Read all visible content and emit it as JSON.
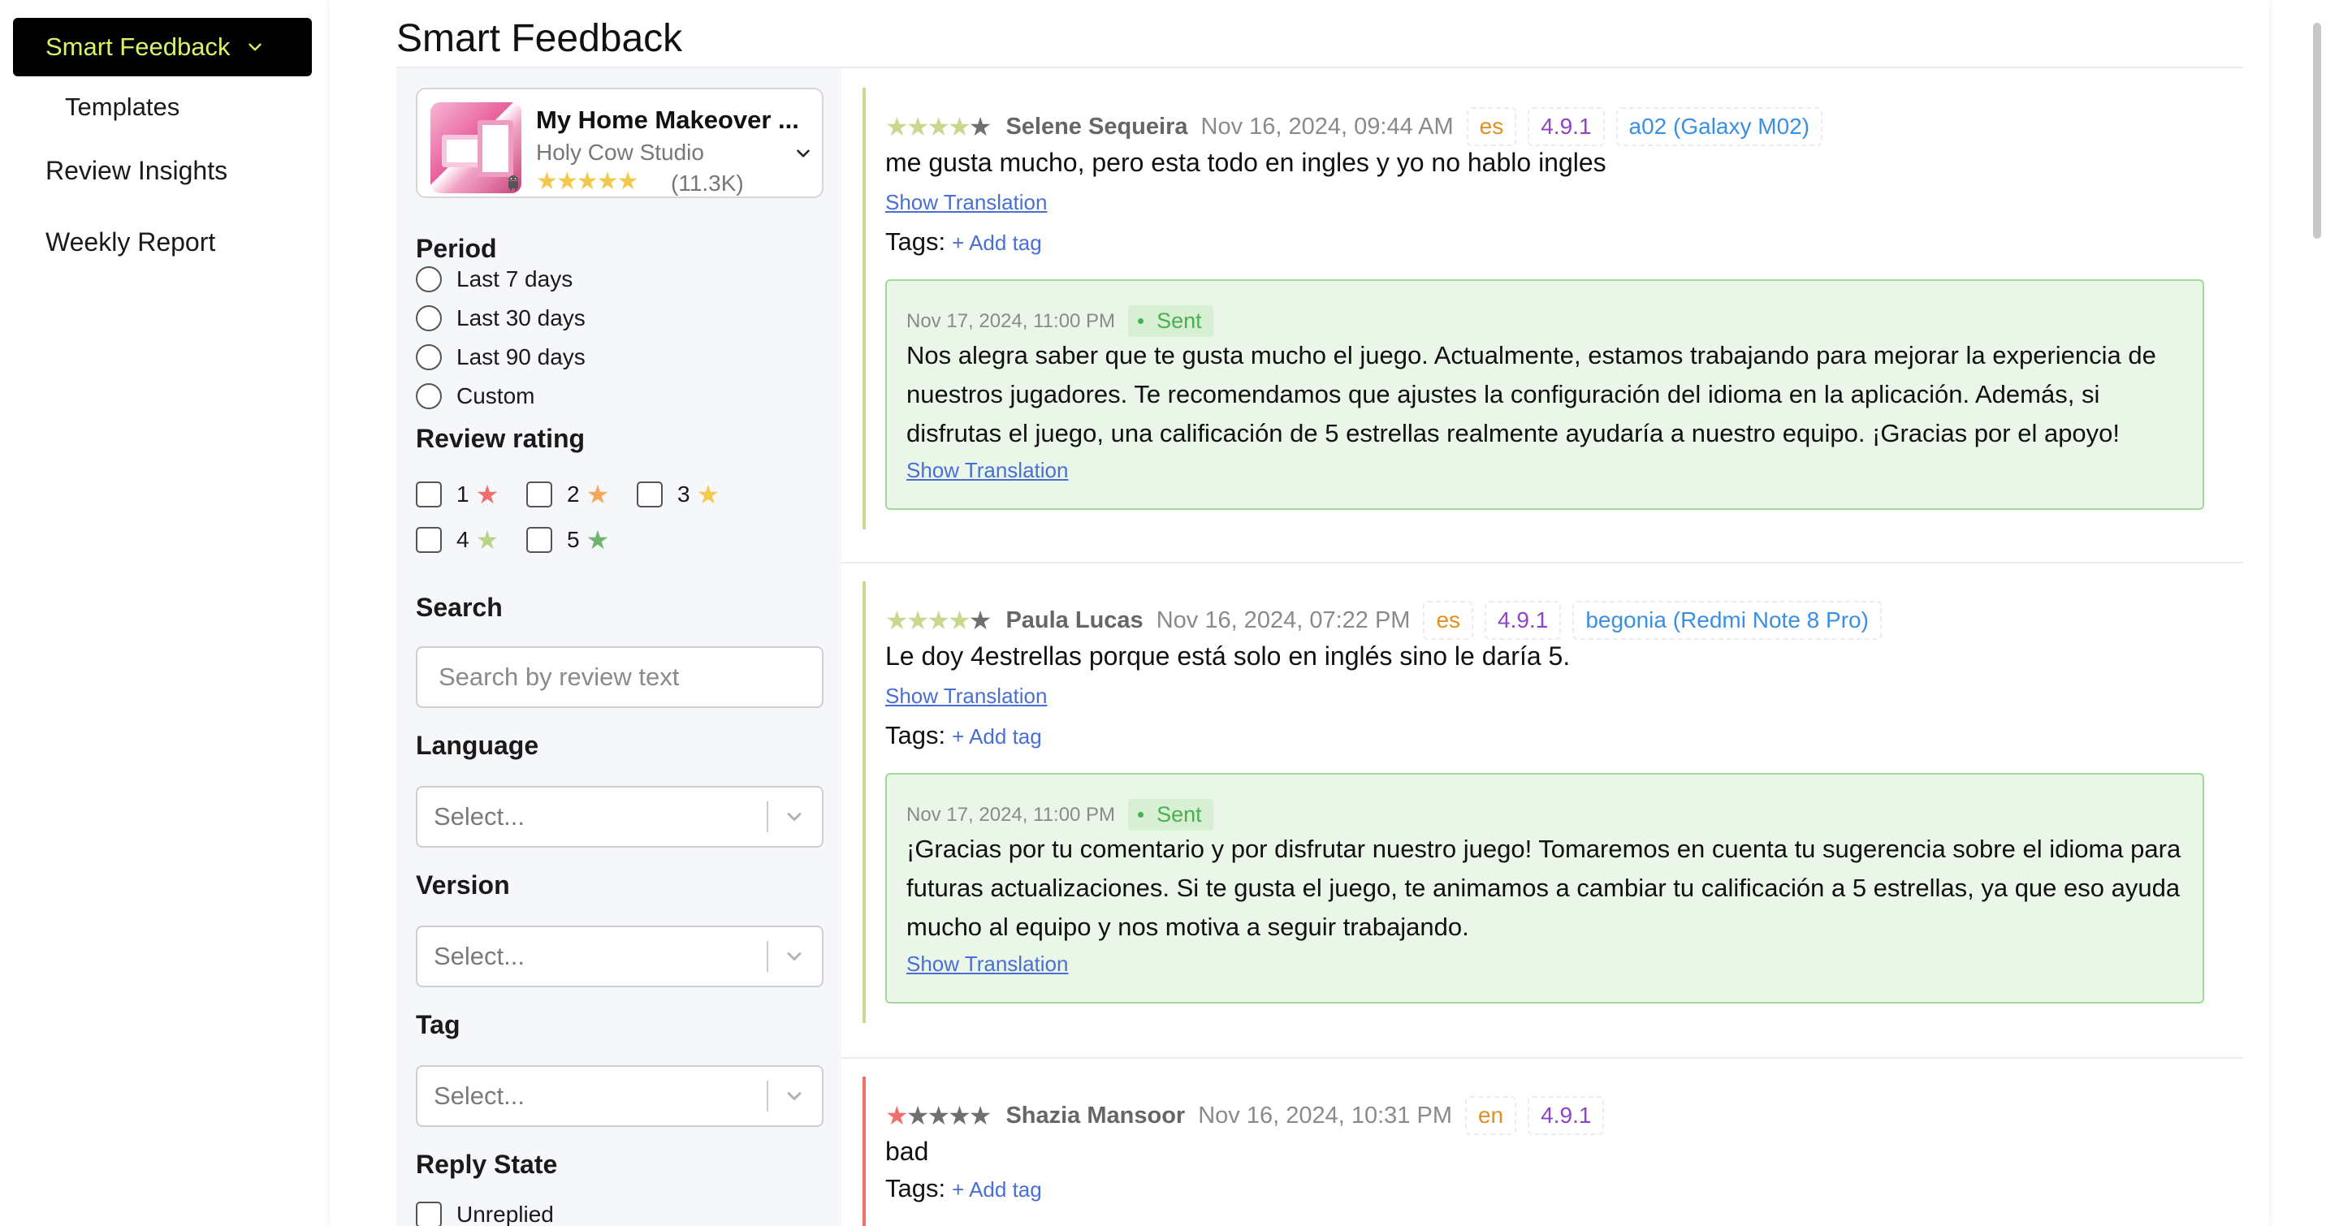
{
  "sidebar": {
    "active_item": "Smart Feedback",
    "sub_item": "Templates",
    "items": [
      "Review Insights",
      "Weekly Report"
    ]
  },
  "page": {
    "title": "Smart Feedback"
  },
  "app": {
    "name": "My Home Makeover ...",
    "developer": "Holy Cow Studio",
    "stars": "★★★★★",
    "rating_count": "(11.3K)",
    "platform_icon": "android-icon"
  },
  "filters": {
    "period": {
      "label": "Period",
      "options": [
        "Last 7 days",
        "Last 30 days",
        "Last 90 days",
        "Custom"
      ]
    },
    "rating": {
      "label": "Review rating",
      "options": [
        {
          "value": "1",
          "color": "#ef6f6c"
        },
        {
          "value": "2",
          "color": "#f5a85b"
        },
        {
          "value": "3",
          "color": "#f2c94c"
        },
        {
          "value": "4",
          "color": "#b9d38a"
        },
        {
          "value": "5",
          "color": "#6fb56f"
        }
      ],
      "star_glyph": "★"
    },
    "search": {
      "label": "Search",
      "placeholder": "Search by review text"
    },
    "language": {
      "label": "Language",
      "placeholder": "Select..."
    },
    "version": {
      "label": "Version",
      "placeholder": "Select..."
    },
    "tag": {
      "label": "Tag",
      "placeholder": "Select..."
    },
    "reply_state": {
      "label": "Reply State",
      "options": [
        "Unreplied"
      ]
    }
  },
  "reviews": [
    {
      "rating": 4,
      "bar_color": "#c8d98f",
      "author": "Selene Sequeira",
      "date": "Nov 16, 2024, 09:44 AM",
      "language": "es",
      "version": "4.9.1",
      "device": "a02 (Galaxy M02)",
      "text": "me gusta mucho, pero esta todo en ingles y yo no hablo ingles",
      "show_translation": "Show Translation",
      "tags_label": "Tags:",
      "add_tag": "+ Add tag",
      "reply": {
        "date": "Nov 17, 2024, 11:00 PM",
        "status": "Sent",
        "text": "Nos alegra saber que te gusta mucho el juego. Actualmente, estamos trabajando para mejorar la experiencia de nuestros jugadores. Te recomendamos que ajustes la configuración del idioma en la aplicación. Además, si disfrutas el juego, una calificación de 5 estrellas realmente ayudaría a nuestro equipo. ¡Gracias por el apoyo!",
        "show_translation": "Show Translation"
      }
    },
    {
      "rating": 4,
      "bar_color": "#c8d98f",
      "author": "Paula Lucas",
      "date": "Nov 16, 2024, 07:22 PM",
      "language": "es",
      "version": "4.9.1",
      "device": "begonia (Redmi Note 8 Pro)",
      "text": "Le doy 4estrellas porque está solo en inglés sino le daría 5.",
      "show_translation": "Show Translation",
      "tags_label": "Tags:",
      "add_tag": "+ Add tag",
      "reply": {
        "date": "Nov 17, 2024, 11:00 PM",
        "status": "Sent",
        "text": "¡Gracias por tu comentario y por disfrutar nuestro juego! Tomaremos en cuenta tu sugerencia sobre el idioma para futuras actualizaciones. Si te gusta el juego, te animamos a cambiar tu calificación a 5 estrellas, ya que eso ayuda mucho al equipo y nos motiva a seguir trabajando.",
        "show_translation": "Show Translation"
      }
    },
    {
      "rating": 1,
      "bar_color": "#ef6f6c",
      "author": "Shazia Mansoor",
      "date": "Nov 16, 2024, 10:31 PM",
      "language": "en",
      "version": "4.9.1",
      "text": "bad",
      "tags_label": "Tags:",
      "add_tag": "+ Add tag"
    }
  ],
  "colors": {
    "accent": "#d6f266",
    "link": "#4a6fd4",
    "lang_badge": "#e0901f",
    "version_badge": "#8e44c7",
    "device_badge": "#3b8fe0",
    "sent": "#4caf50",
    "reply_bg": "#eaf6e8",
    "star_gold": "#f2c94c",
    "star_empty": "#6f6f6f"
  }
}
